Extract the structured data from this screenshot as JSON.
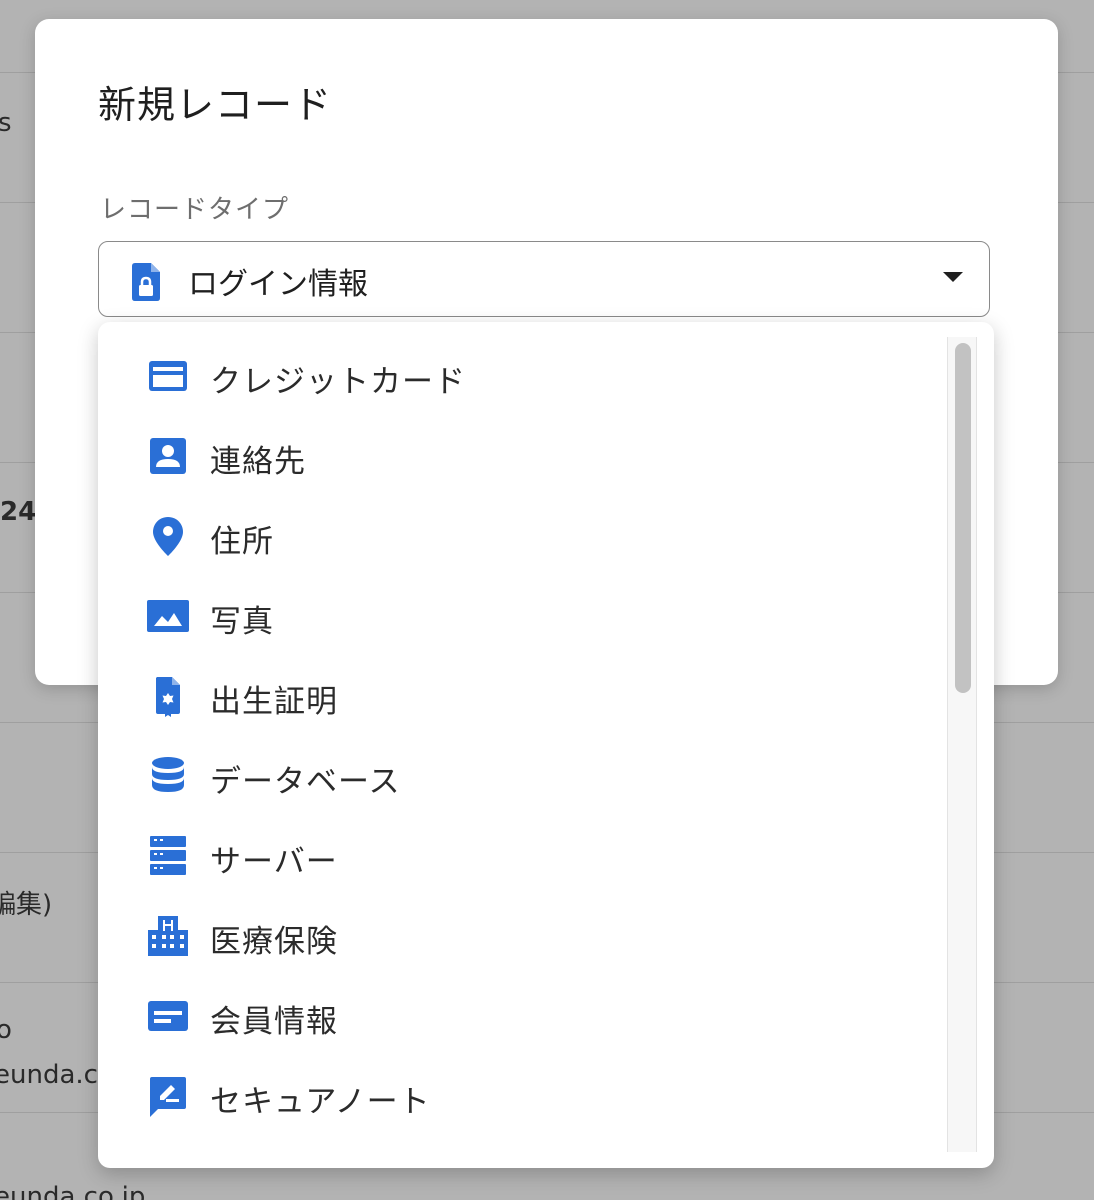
{
  "background": {
    "fragments": [
      "s",
      "24",
      "編集)",
      "o",
      "eunda.co",
      "eunda.co.jp"
    ]
  },
  "dialog": {
    "title": "新規レコード",
    "field_label": "レコードタイプ",
    "selected": {
      "label": "ログイン情報",
      "icon": "login-lock-icon"
    }
  },
  "menu": {
    "items": [
      {
        "label": "クレジットカード",
        "icon": "credit-card-icon"
      },
      {
        "label": "連絡先",
        "icon": "contact-icon"
      },
      {
        "label": "住所",
        "icon": "location-pin-icon"
      },
      {
        "label": "写真",
        "icon": "photo-icon"
      },
      {
        "label": "出生証明",
        "icon": "certificate-icon"
      },
      {
        "label": "データベース",
        "icon": "database-icon"
      },
      {
        "label": "サーバー",
        "icon": "server-icon"
      },
      {
        "label": "医療保険",
        "icon": "hospital-icon"
      },
      {
        "label": "会員情報",
        "icon": "membership-card-icon"
      },
      {
        "label": "セキュアノート",
        "icon": "secure-note-icon"
      }
    ]
  },
  "colors": {
    "accent": "#2a6fd6",
    "overlay": "#b3b3b3"
  }
}
